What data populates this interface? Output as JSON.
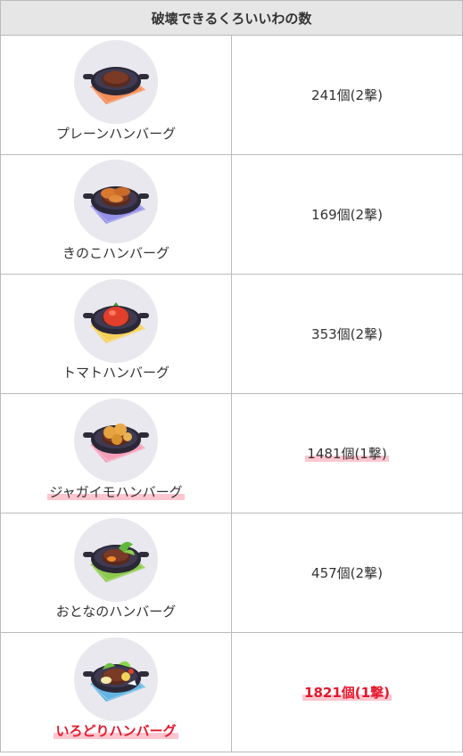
{
  "table": {
    "header": "破壊できるくろいいわの数",
    "rows": [
      {
        "name": "プレーンハンバーグ",
        "count": "241個(2撃)",
        "mat_color": "#f4874f",
        "topping": "plain"
      },
      {
        "name": "きのこハンバーグ",
        "count": "169個(2撃)",
        "mat_color": "#8f8ce8",
        "topping": "mushroom"
      },
      {
        "name": "トマトハンバーグ",
        "count": "353個(2撃)",
        "mat_color": "#f6d052",
        "topping": "tomato"
      },
      {
        "name": "ジャガイモハンバーグ",
        "count": "1481個(1撃)",
        "mat_color": "#f59ab4",
        "topping": "potato"
      },
      {
        "name": "おとなのハンバーグ",
        "count": "457個(2撃)",
        "mat_color": "#88c742",
        "topping": "veggie"
      },
      {
        "name": "いろどりハンバーグ",
        "count": "1821個(1撃)",
        "mat_color": "#5cb1e0",
        "topping": "colorful"
      }
    ]
  }
}
